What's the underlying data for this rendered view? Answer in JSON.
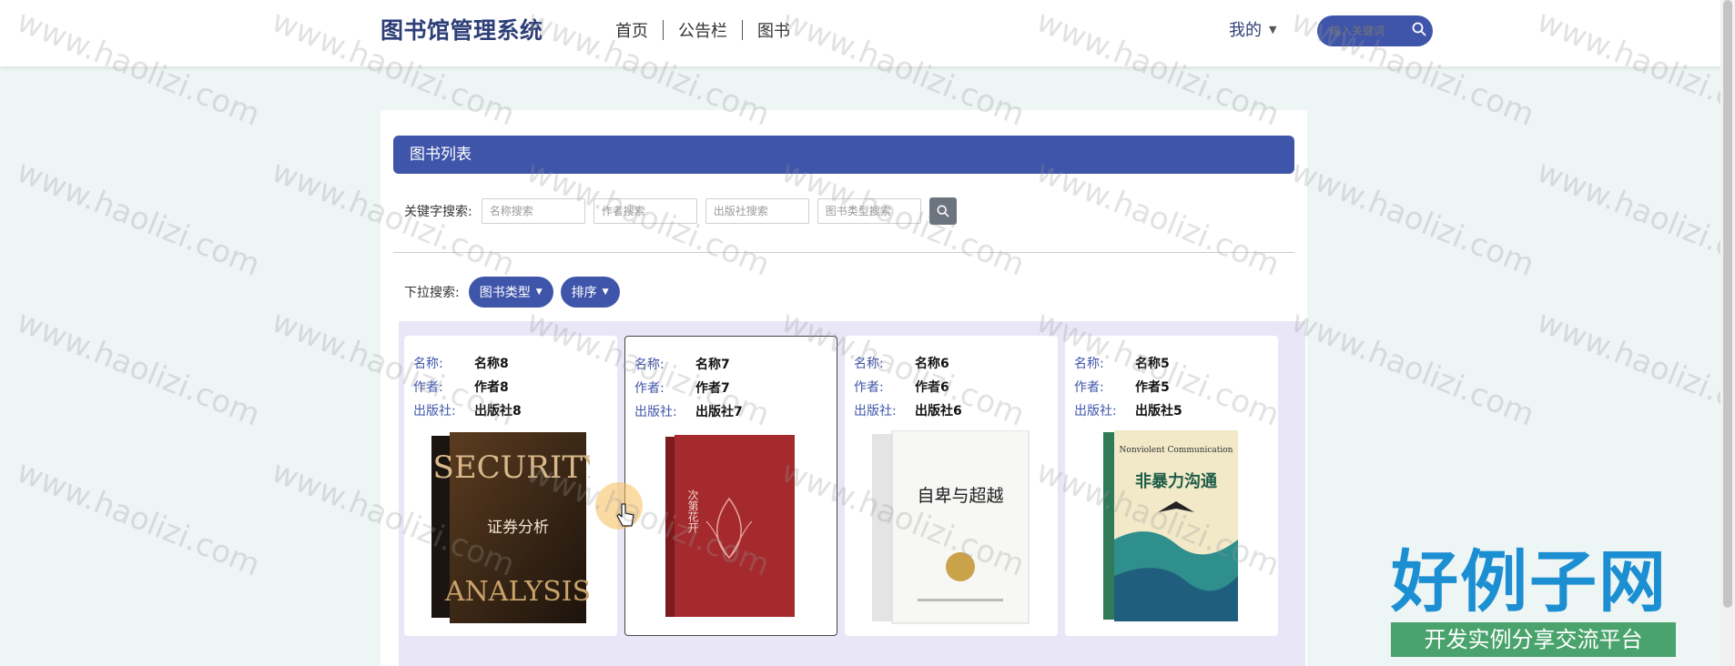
{
  "header": {
    "logo": "图书馆管理系统",
    "nav": [
      "首页",
      "公告栏",
      "图书"
    ],
    "user_menu": "我的",
    "search_placeholder": "输入关键词"
  },
  "main": {
    "list_title": "图书列表",
    "keyword_label": "关键字搜索:",
    "inputs": [
      {
        "placeholder": "名称搜索"
      },
      {
        "placeholder": "作者搜索"
      },
      {
        "placeholder": "出版社搜索"
      },
      {
        "placeholder": "图书类型搜索"
      }
    ],
    "dropdown_label": "下拉搜索:",
    "dropdowns": [
      "图书类型",
      "排序"
    ],
    "field_labels": {
      "name": "名称:",
      "author": "作者:",
      "publisher": "出版社:"
    },
    "books": [
      {
        "name": "名称8",
        "author": "作者8",
        "publisher": "出版社8",
        "cover_title": "SECURITY",
        "cover_sub": "证券分析",
        "cover_bottom": "ANALYSIS"
      },
      {
        "name": "名称7",
        "author": "作者7",
        "publisher": "出版社7",
        "cover_title": "",
        "cover_sub": "次第花开",
        "cover_bottom": ""
      },
      {
        "name": "名称6",
        "author": "作者6",
        "publisher": "出版社6",
        "cover_title": "",
        "cover_sub": "自卑与超越",
        "cover_bottom": ""
      },
      {
        "name": "名称5",
        "author": "作者5",
        "publisher": "出版社5",
        "cover_title": "Nonviolent Communication",
        "cover_sub": "非暴力沟通",
        "cover_bottom": ""
      }
    ]
  },
  "watermark": {
    "text": "www.haolizi.com",
    "logo": "好例子网",
    "logo_sub": "开发实例分享交流平台"
  },
  "colors": {
    "accent": "#3f55aa",
    "logo": "#2e3f78",
    "card_area": "#e9e7f7"
  }
}
